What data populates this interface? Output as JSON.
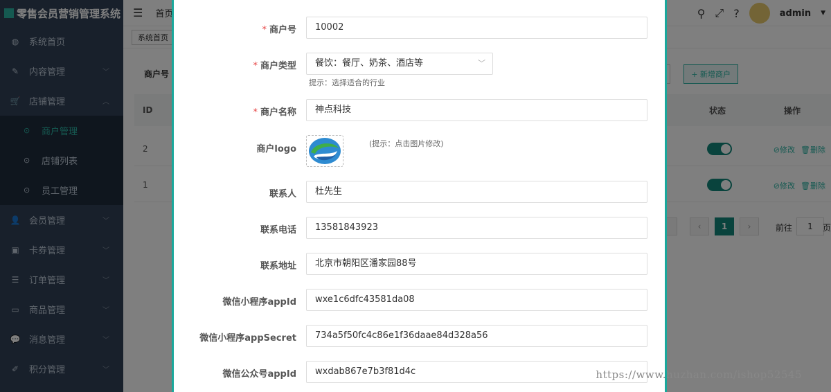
{
  "app": {
    "title": "零售会员营销管理系统"
  },
  "sidebar": {
    "items": [
      {
        "label": "系统首页",
        "icon": "dashboard-icon"
      },
      {
        "label": "内容管理",
        "icon": "edit-icon"
      },
      {
        "label": "店铺管理",
        "icon": "cart-icon"
      },
      {
        "label": "会员管理",
        "icon": "user-icon"
      },
      {
        "label": "卡券管理",
        "icon": "coupon-icon"
      },
      {
        "label": "订单管理",
        "icon": "list-icon"
      },
      {
        "label": "商品管理",
        "icon": "monitor-icon"
      },
      {
        "label": "消息管理",
        "icon": "message-icon"
      },
      {
        "label": "积分管理",
        "icon": "points-icon"
      }
    ],
    "store_submenu": [
      {
        "label": "商户管理",
        "active": true
      },
      {
        "label": "店铺列表",
        "active": false
      },
      {
        "label": "员工管理",
        "active": false
      }
    ]
  },
  "header": {
    "breadcrumb": "首页",
    "user": "admin"
  },
  "tags": {
    "home": "系统首页"
  },
  "page": {
    "filter_label": "商户号",
    "add_button": "+ 新增商户",
    "table": {
      "columns": {
        "id": "ID",
        "status": "状态",
        "actions": "操作"
      },
      "rows": [
        {
          "id": "2",
          "status": true,
          "edit": "⊘修改",
          "delete": "🗑删除"
        },
        {
          "id": "1",
          "status": true,
          "edit": "⊘修改",
          "delete": "🗑删除"
        }
      ]
    },
    "pagination": {
      "current": "1",
      "goto_label": "前往",
      "goto_value": "1",
      "page_suffix": "页"
    }
  },
  "form": {
    "merchant_no": {
      "label": "商户号",
      "required": true,
      "value": "10002"
    },
    "merchant_type": {
      "label": "商户类型",
      "required": true,
      "value": "餐饮：餐厅、奶茶、酒店等",
      "hint": "提示：选择适合的行业"
    },
    "merchant_name": {
      "label": "商户名称",
      "required": true,
      "value": "神点科技"
    },
    "merchant_logo": {
      "label": "商户logo",
      "hint": "(提示：点击图片修改)"
    },
    "contact": {
      "label": "联系人",
      "value": "杜先生"
    },
    "phone": {
      "label": "联系电话",
      "value": "13581843923"
    },
    "address": {
      "label": "联系地址",
      "value": "北京市朝阳区潘家园88号"
    },
    "mini_appid": {
      "label": "微信小程序appId",
      "value": "wxe1c6dfc43581da08"
    },
    "mini_secret": {
      "label": "微信小程序appSecret",
      "value": "734a5f50fc4c86e1f36daae84d328a56"
    },
    "mp_appid": {
      "label": "微信公众号appId",
      "value": "wxdab867e7b3f81d4c"
    },
    "required_mark": "*"
  },
  "watermark": "https://www.huzhan.com/ishop52545",
  "colors": {
    "sidebar_bg": "#304156",
    "accent": "#2bb3a3",
    "modal_border": "#1aa89c",
    "required": "#e64343"
  }
}
